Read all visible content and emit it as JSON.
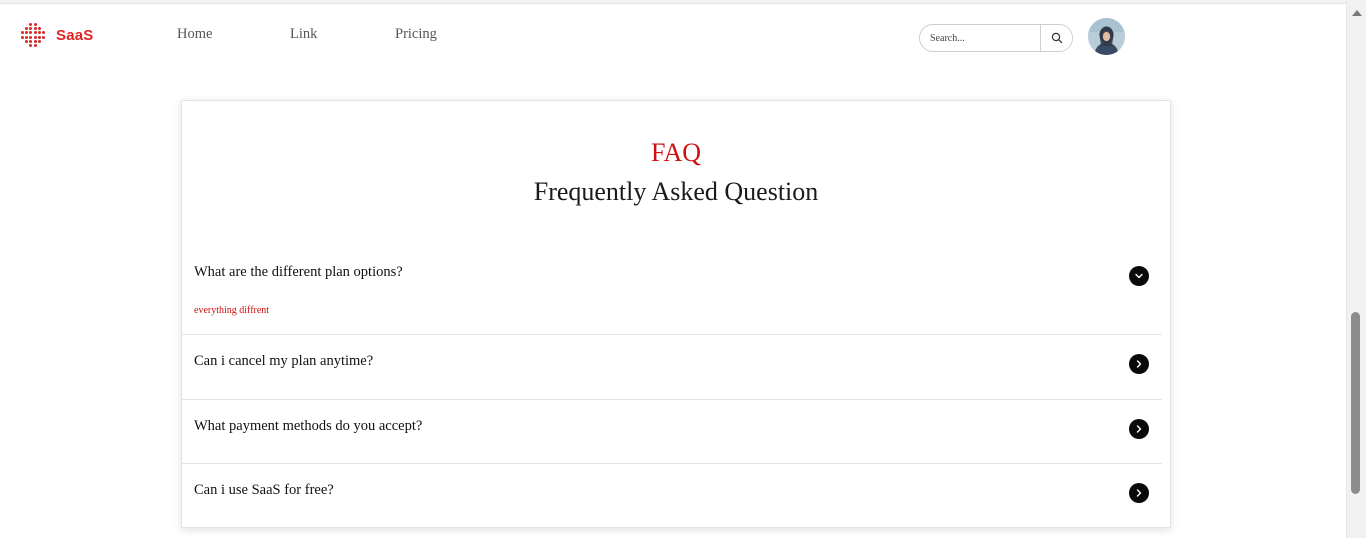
{
  "navbar": {
    "brand": "SaaS",
    "brand_color": "#e02424",
    "links": [
      "Home",
      "Link",
      "Pricing"
    ],
    "search": {
      "placeholder": "Search...",
      "value": "",
      "icon": "search-icon"
    },
    "avatar": "user-avatar"
  },
  "faq": {
    "eyebrow": "FAQ",
    "title": "Frequently Asked Question",
    "accent_color": "#cc1111",
    "items": [
      {
        "question": "What are the different plan options?",
        "answer": "everything diffrent",
        "expanded": true,
        "icon": "chevron-down-icon"
      },
      {
        "question": "Can i cancel my plan anytime?",
        "answer": "",
        "expanded": false,
        "icon": "chevron-right-icon"
      },
      {
        "question": "What payment methods do you accept?",
        "answer": "",
        "expanded": false,
        "icon": "chevron-right-icon"
      },
      {
        "question": "Can i use SaaS for free?",
        "answer": "",
        "expanded": false,
        "icon": "chevron-right-icon"
      }
    ]
  }
}
